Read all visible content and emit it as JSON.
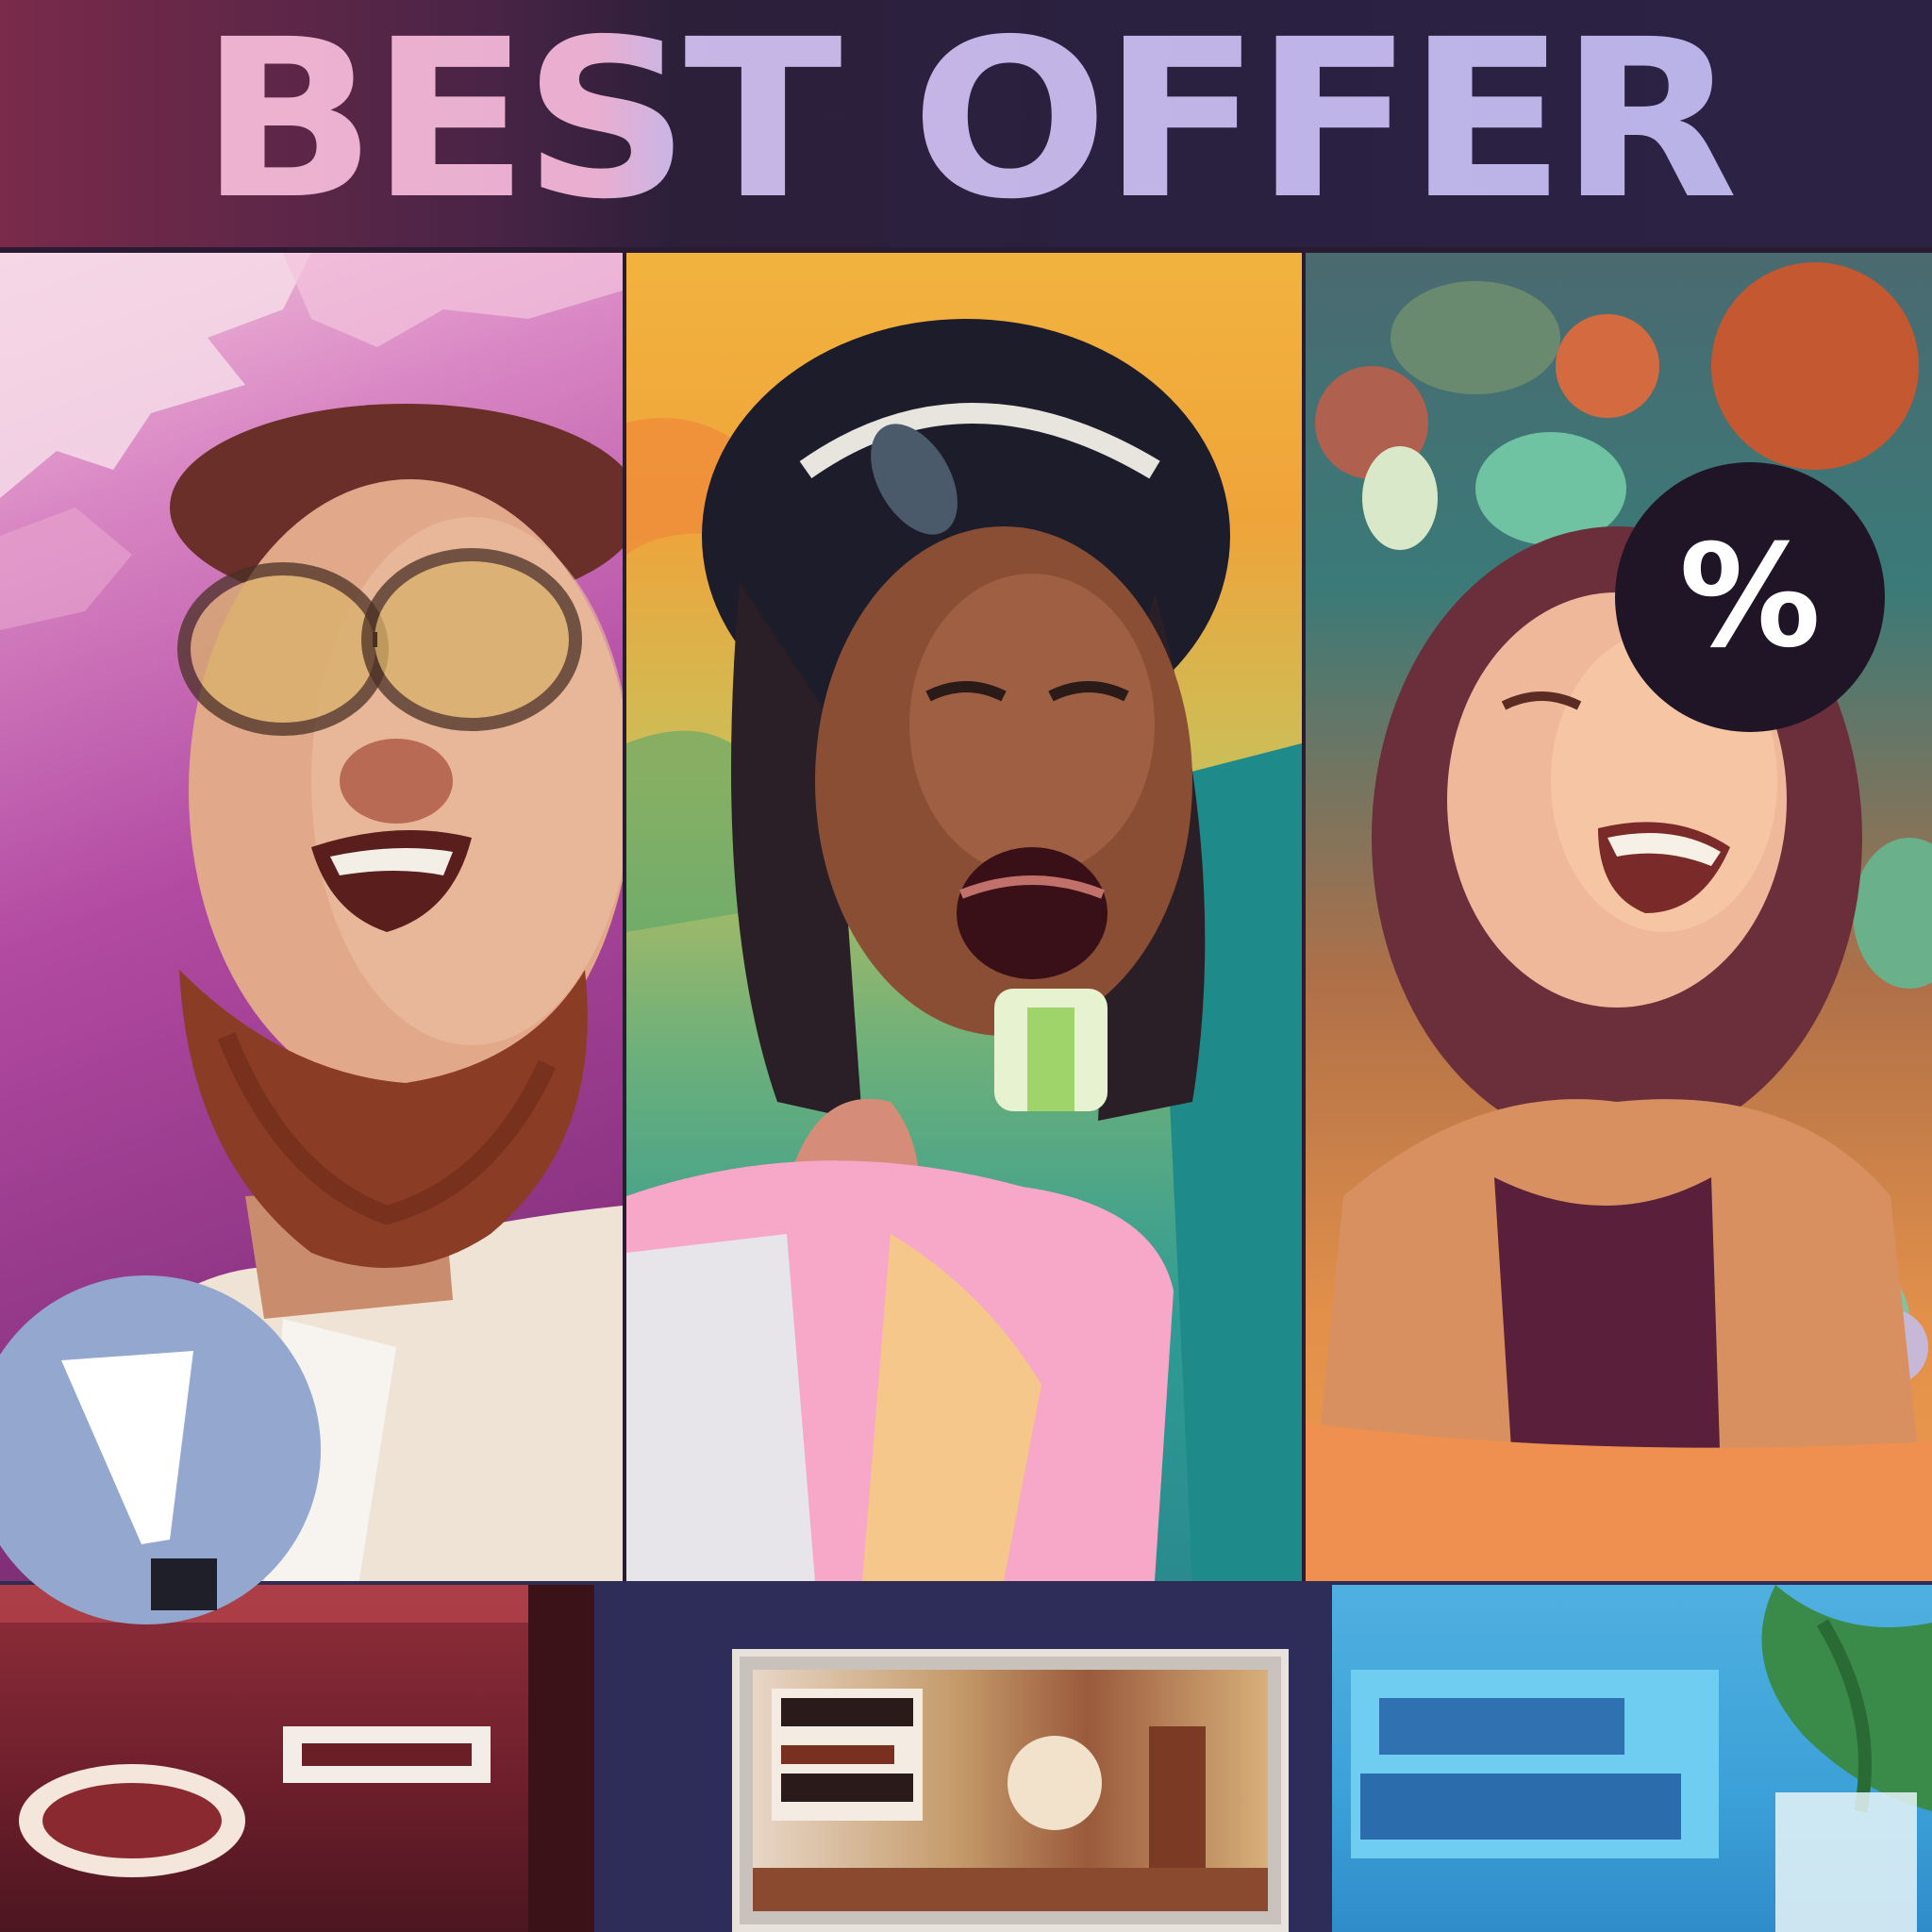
{
  "headline": "BEST OFFER",
  "badges": {
    "discount_symbol": "%",
    "alert_icon": "exclamation-icon"
  },
  "colors": {
    "header_bg": "#2c1f3a",
    "headline_pink": "#e9aed0",
    "headline_lavender": "#b6b2e8",
    "panel_magenta": "#b24aa2",
    "panel_yellow": "#f2b33e",
    "panel_teal": "#2f9c94",
    "panel_orange": "#ee9a4e",
    "badge_dark": "#1f1526",
    "badge_blue": "#93a7cf"
  },
  "panels": [
    {
      "subject": "bearded-man-with-glasses"
    },
    {
      "subject": "woman-eating"
    },
    {
      "subject": "laughing-woman-with-flowers"
    }
  ],
  "thumbnails": [
    {
      "subject": "red-storefront-sign"
    },
    {
      "subject": "framed-store-display"
    },
    {
      "subject": "blue-sign-with-plant"
    }
  ]
}
